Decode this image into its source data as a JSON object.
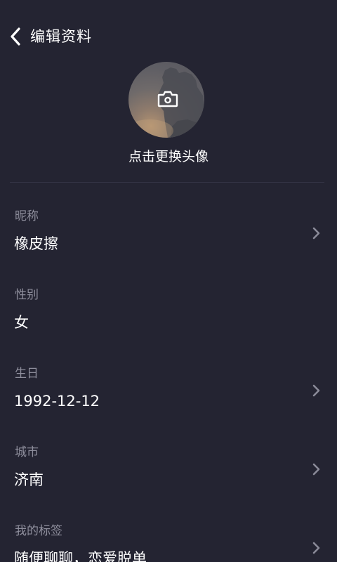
{
  "header": {
    "title": "编辑资料",
    "back_icon": "chevron-left-icon"
  },
  "avatar": {
    "icon": "camera-icon",
    "hint": "点击更换头像"
  },
  "fields": [
    {
      "label": "昵称",
      "value": "橡皮擦",
      "has_arrow": true
    },
    {
      "label": "性别",
      "value": "女",
      "has_arrow": false
    },
    {
      "label": "生日",
      "value": "1992-12-12",
      "has_arrow": true
    },
    {
      "label": "城市",
      "value": "济南",
      "has_arrow": true
    },
    {
      "label": "我的标签",
      "value": "随便聊聊，恋爱脱单",
      "has_arrow": true
    }
  ],
  "colors": {
    "background": "#242432",
    "label": "#8e8e9c",
    "value": "#ffffff",
    "chevron": "#8a8a98",
    "divider": "#353546"
  }
}
